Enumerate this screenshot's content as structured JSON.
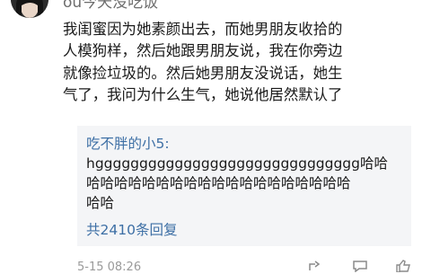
{
  "comment": {
    "username": "ou今天没吃饭",
    "lines": [
      "我闺蜜因为她素颜出去，而她男朋友收拾的",
      "人模狗样，然后她跟男朋友说，我在你旁边",
      "就像捡垃圾的。然后她男朋友没说话，她生",
      "气了，我问为什么生气，她说他居然默认了"
    ]
  },
  "reply": {
    "author": "吃不胖的小5:",
    "lines": [
      "hgggggggggggggggggggggggggggggg哈哈",
      "哈哈哈哈哈哈哈哈哈哈哈哈哈哈哈哈哈哈哈",
      "哈哈"
    ],
    "count_label": "共2410条回复"
  },
  "footer": {
    "timestamp": "5-15 08:26"
  },
  "icons": {
    "avatar": "avatar",
    "share": "share-icon",
    "comment": "comment-icon",
    "like": "like-icon"
  },
  "colors": {
    "link": "#3d6fa5",
    "reply_bg": "#f4f5f7",
    "meta": "#9a9a9a"
  }
}
